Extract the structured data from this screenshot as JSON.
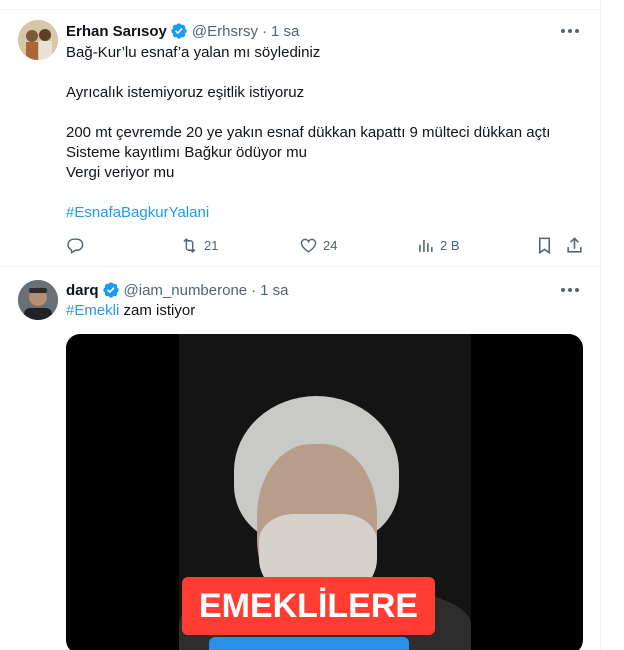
{
  "tweets": [
    {
      "author": "Erhan Sarısoy",
      "handle": "@Erhsrsy",
      "time": "1 sa",
      "lines": [
        "Bağ-Kur’lu esnaf’a yalan mı söylediniz",
        "",
        "Ayrıcalık istemiyoruz eşitlik istiyoruz",
        "",
        "200 mt çevremde 20 ye yakın esnaf dükkan kapattı 9 mülteci dükkan açtı",
        "Sisteme kayıtlımı Bağkur ödüyor mu",
        "Vergi veriyor mu",
        ""
      ],
      "hashtag": "#EsnafaBagkurYalani",
      "stats": {
        "retweets": "21",
        "likes": "24",
        "views": "2 B"
      }
    },
    {
      "author": "darq",
      "handle": "@iam_numberone",
      "time": "1 sa",
      "hashtag": "#Emekli",
      "text_after_hashtag": " zam istiyor",
      "video_caption": "EMEKLİLERE"
    }
  ],
  "separator": "·",
  "icons": [
    "verified-badge-icon",
    "more-icon",
    "reply-icon",
    "retweet-icon",
    "like-icon",
    "views-icon",
    "bookmark-icon",
    "share-icon"
  ],
  "colors": {
    "accent": "#1d9bf0",
    "secondary_text": "#536471",
    "caption_red": "#ff3d33",
    "caption_blue": "#2a8fe8"
  }
}
